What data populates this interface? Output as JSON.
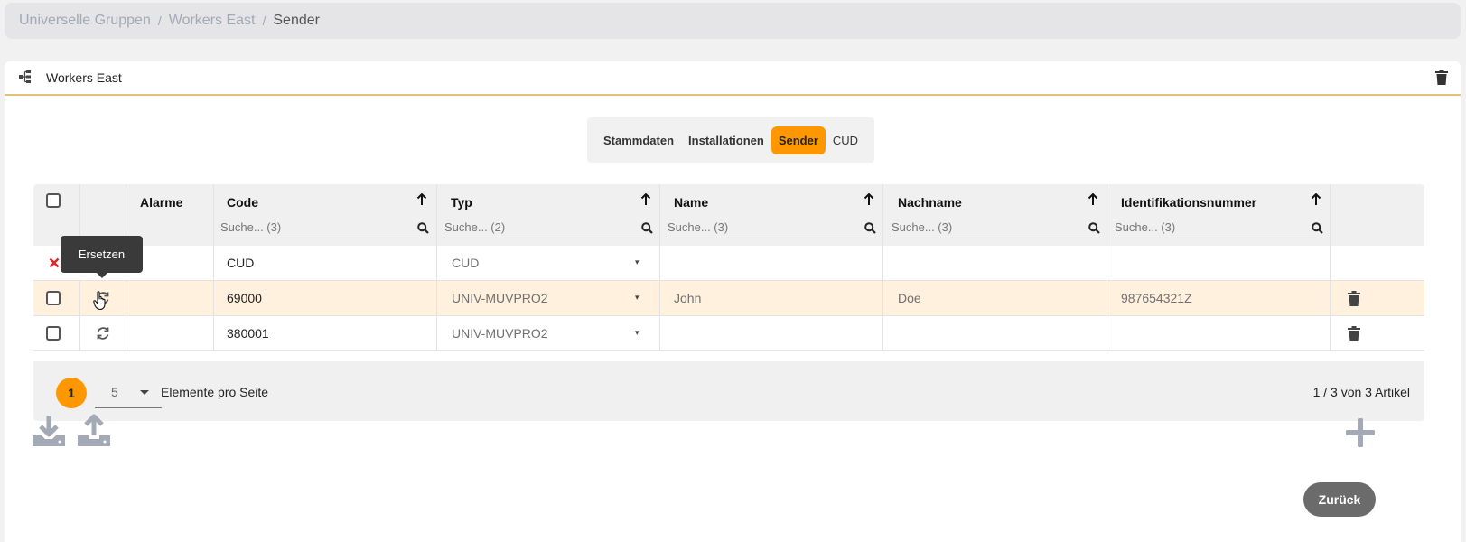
{
  "breadcrumb": {
    "items": [
      "Universelle Gruppen",
      "Workers East"
    ],
    "separator": "/",
    "current": "Sender"
  },
  "card": {
    "title": "Workers East"
  },
  "tabs": [
    {
      "label": "Stammdaten",
      "active": false
    },
    {
      "label": "Installationen",
      "active": false
    },
    {
      "label": "Sender",
      "active": true
    },
    {
      "label": "CUD",
      "active": false
    }
  ],
  "table": {
    "columns": {
      "alarme": "Alarme",
      "code": "Code",
      "typ": "Typ",
      "name": "Name",
      "nachname": "Nachname",
      "ident": "Identifikationsnummer"
    },
    "filters": {
      "code": "Suche... (3)",
      "typ": "Suche... (2)",
      "name": "Suche... (3)",
      "nachname": "Suche... (3)",
      "ident": "Suche... (3)"
    },
    "rows": [
      {
        "code": "CUD",
        "typ": "CUD",
        "name": "",
        "nachname": "",
        "ident": ""
      },
      {
        "code": "69000",
        "typ": "UNIV-MUVPRO2",
        "name": "John",
        "nachname": "Doe",
        "ident": "987654321Z"
      },
      {
        "code": "380001",
        "typ": "UNIV-MUVPRO2",
        "name": "",
        "nachname": "",
        "ident": ""
      }
    ]
  },
  "tooltip": {
    "text": "Ersetzen"
  },
  "pager": {
    "page": "1",
    "page_size": "5",
    "per_page_label": "Elemente pro Seite",
    "info": "1 / 3 von 3 Artikel"
  },
  "actions": {
    "back_label": "Zurück"
  },
  "colors": {
    "accent": "#ff9800",
    "highlight_row": "#fff1de",
    "delete_x": "#e02424"
  }
}
